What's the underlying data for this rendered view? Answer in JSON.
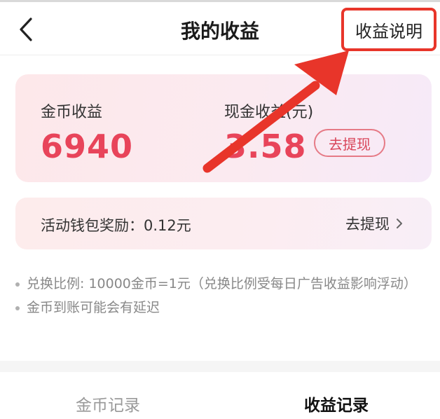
{
  "header": {
    "title": "我的收益",
    "explain_label": "收益说明"
  },
  "earnings": {
    "coin_label": "金币收益",
    "coin_value": "6940",
    "cash_label": "现金收益(元)",
    "cash_value": "3.58",
    "withdraw_label": "去提现"
  },
  "activity": {
    "text": "活动钱包奖励：0.12元",
    "link_label": "去提现"
  },
  "notes": [
    "兑换比例: 10000金币=1元（兑换比例受每日广告收益影响浮动）",
    "金币到账可能会有延迟"
  ],
  "tabs": [
    {
      "label": "金币记录",
      "active": false
    },
    {
      "label": "收益记录",
      "active": true
    }
  ],
  "colors": {
    "accent": "#e8445a",
    "annotation": "#e8352a"
  },
  "icons": {
    "back": "chevron-left-icon",
    "link": "chevron-right-icon"
  }
}
